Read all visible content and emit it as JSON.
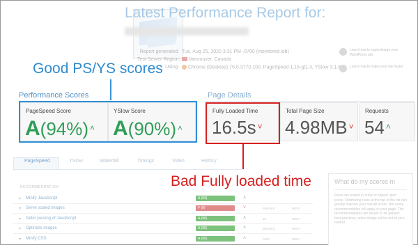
{
  "header": {
    "title": "Latest Performance Report for:",
    "meta": [
      {
        "label": "Report generated:",
        "value": "Tue, Aug 25, 2020 3:31 PM -0700 (monitored job)"
      },
      {
        "label": "Test Server Region:",
        "value": "Vancouver, Canada"
      },
      {
        "label": "Using:",
        "value": "Chrome (Desktop) 75.0.3770.100, PageSpeed 1.15-gt1.3, YSlow 3.1.8"
      }
    ],
    "side_notes": [
      "Learn how to supercharge your WordPress site",
      "Learn how to make your site faster"
    ]
  },
  "annotations": {
    "good": "Good PS/YS scores",
    "bad": "Bad Fully loaded time"
  },
  "performance_scores": {
    "heading": "Performance Scores",
    "pagespeed": {
      "label": "PageSpeed Score",
      "grade": "A",
      "value": "(94%)"
    },
    "yslow": {
      "label": "YSlow Score",
      "grade": "A",
      "value": "(90%)"
    }
  },
  "page_details": {
    "heading": "Page Details",
    "fully_loaded": {
      "label": "Fully Loaded Time",
      "value": "16.5s"
    },
    "page_size": {
      "label": "Total Page Size",
      "value": "4.98MB"
    },
    "requests": {
      "label": "Requests",
      "value": "54"
    }
  },
  "tabs": [
    "PageSpeed",
    "YSlow",
    "Waterfall",
    "Timings",
    "Video",
    "History"
  ],
  "table": {
    "header": "RECOMMENDATION",
    "rows": [
      {
        "name": "Minify JavaScript",
        "grade": "A (93)",
        "color": "#7cc27c",
        "trend": "up",
        "c1": "",
        "c2": ""
      },
      {
        "name": "Serve scaled images",
        "grade": "F (0)",
        "color": "#e08a8a",
        "trend": "down",
        "c1": "IMAGES",
        "c2": "HIGH"
      },
      {
        "name": "Defer parsing of JavaScript",
        "grade": "A (96)",
        "color": "#7cc27c",
        "trend": "up",
        "c1": "JS",
        "c2": "HIGH"
      },
      {
        "name": "Optimize images",
        "grade": "A (95)",
        "color": "#7cc27c",
        "trend": "up",
        "c1": "IMAGES",
        "c2": "HIGH"
      },
      {
        "name": "Minify CSS",
        "grade": "A (90)",
        "color": "#7cc27c",
        "trend": "up",
        "c1": "CSS",
        "c2": "HIGH"
      }
    ]
  },
  "right_panel": {
    "heading": "What do my scores m",
    "text": "Rules are sorted in order of impact upon score. Optimizing rules at the top of the list can greatly improve your overall score. Not every recommendation will apply to your page. The recommendations are meant to be generic, best practices; some things will be out of your control."
  },
  "colors": {
    "accent_blue": "#2f8fd8",
    "accent_red": "#d61f1f",
    "grade_green": "#2f9d57"
  }
}
